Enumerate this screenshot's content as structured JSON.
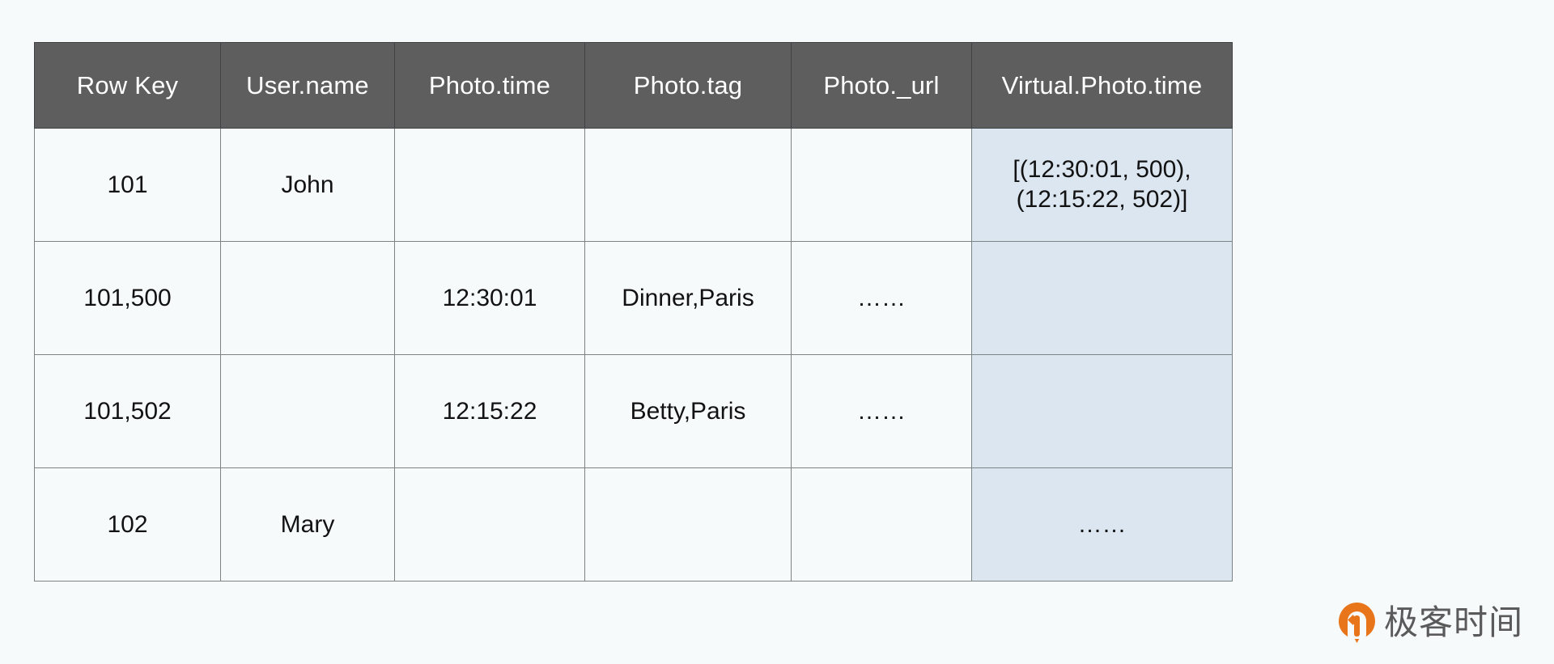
{
  "table": {
    "headers": [
      "Row Key",
      "User.name",
      "Photo.time",
      "Photo.tag",
      "Photo._url",
      "Virtual.Photo.time"
    ],
    "rows": [
      {
        "row_key": "101",
        "user_name": "John",
        "photo_time": "",
        "photo_tag": "",
        "photo_url": "",
        "virtual_photo_time": "[(12:30:01, 500),\n(12:15:22, 502)]"
      },
      {
        "row_key": "101,500",
        "user_name": "",
        "photo_time": "12:30:01",
        "photo_tag": "Dinner,Paris",
        "photo_url": "……",
        "virtual_photo_time": ""
      },
      {
        "row_key": "101,502",
        "user_name": "",
        "photo_time": "12:15:22",
        "photo_tag": "Betty,Paris",
        "photo_url": "……",
        "virtual_photo_time": ""
      },
      {
        "row_key": "102",
        "user_name": "Mary",
        "photo_time": "",
        "photo_tag": "",
        "photo_url": "",
        "virtual_photo_time": "……"
      }
    ]
  },
  "watermark": {
    "brand": "极客时间"
  },
  "colors": {
    "header_background": "#5e5e5e",
    "header_text": "#ffffff",
    "cell_background": "#f7fafb",
    "highlight_background": "#dbe6f1",
    "border": "#7c8385",
    "page_background": "#f7fafb",
    "logo_orange": "#e8751a"
  }
}
